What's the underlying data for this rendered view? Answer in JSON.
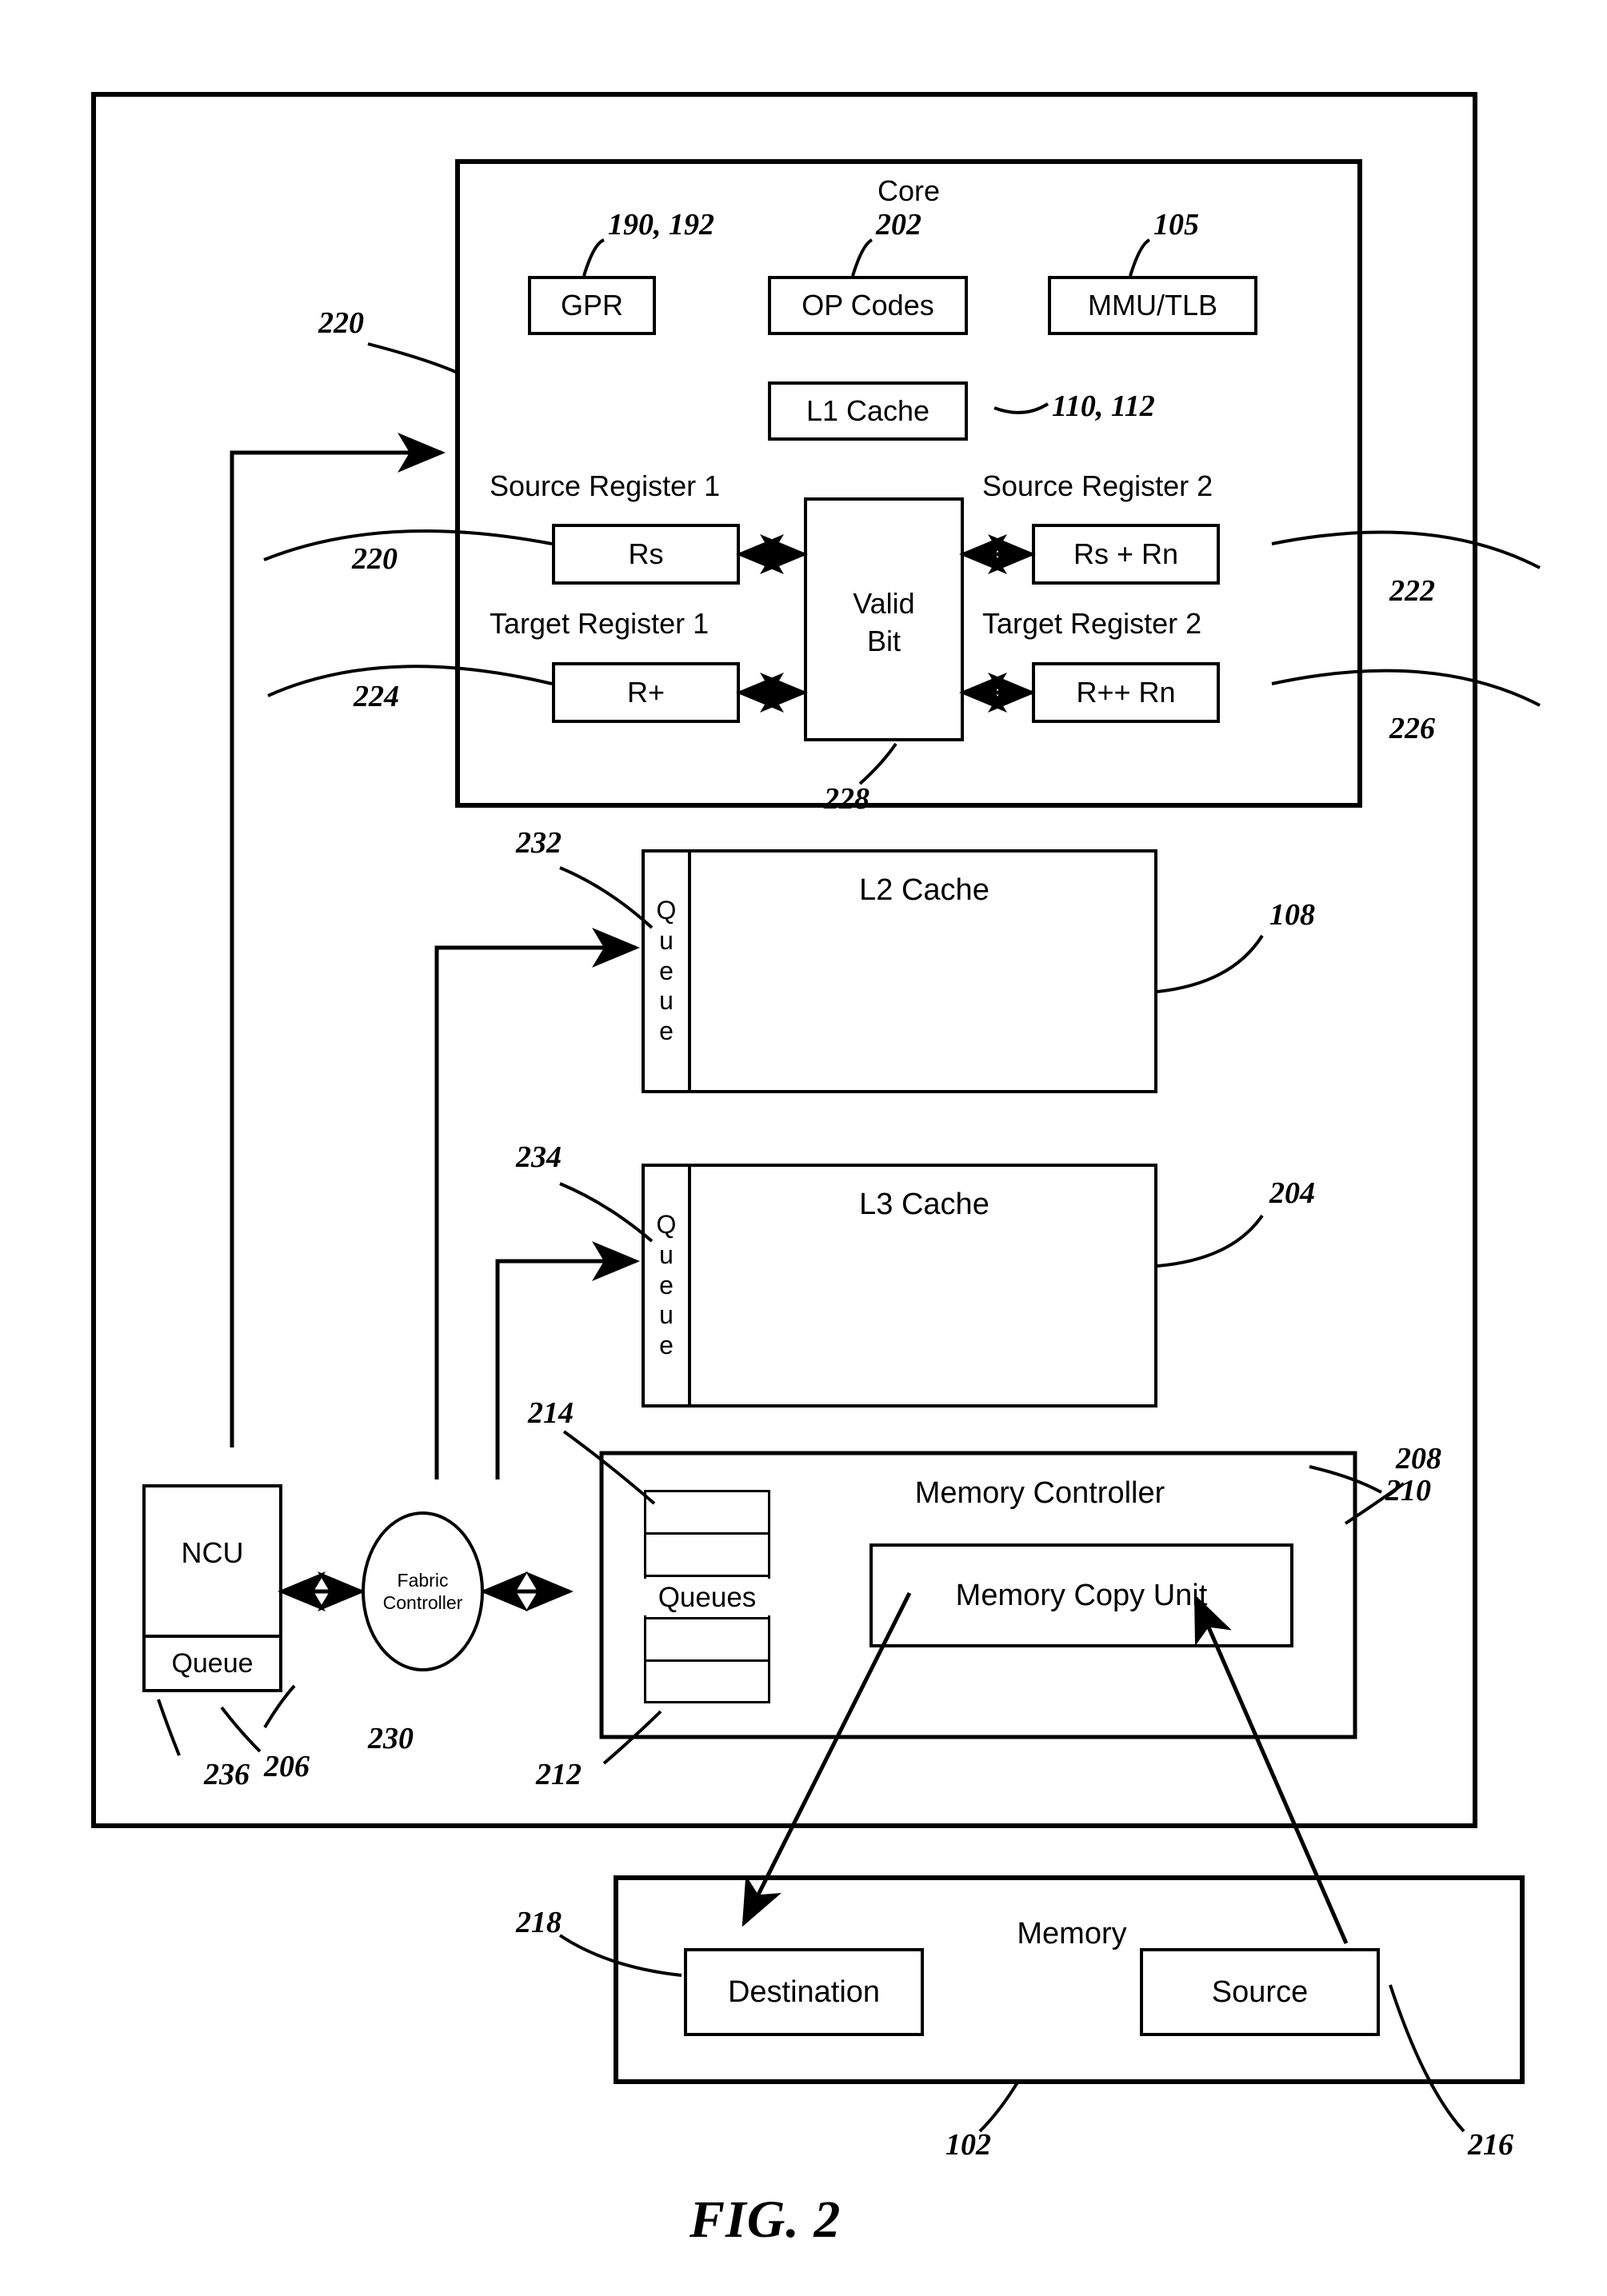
{
  "figure": {
    "caption": "FIG. 2"
  },
  "chip": {
    "core": {
      "title": "Core",
      "units": [
        {
          "label": "GPR",
          "ref": "190, 192"
        },
        {
          "label": "OP Codes",
          "ref": "202"
        },
        {
          "label": "MMU/TLB",
          "ref": "105"
        },
        {
          "label": "L1 Cache",
          "ref": "110, 112"
        }
      ],
      "registers": {
        "source_register_1": {
          "title": "Source Register 1",
          "value": "Rs",
          "ref": "220"
        },
        "source_register_2": {
          "title": "Source Register 2",
          "value": "Rs + Rn",
          "ref": "222"
        },
        "target_register_1": {
          "title": "Target Register 1",
          "value": "R+",
          "ref": "224"
        },
        "target_register_2": {
          "title": "Target Register 2",
          "value": "R++ Rn",
          "ref": "226"
        },
        "valid_bit": {
          "line1": "Valid",
          "line2": "Bit",
          "ref": "228"
        }
      },
      "inbound_ref": "220"
    },
    "l2_cache": {
      "label": "L2 Cache",
      "queue_label": "Queue",
      "queue_ref": "232",
      "ref": "108"
    },
    "l3_cache": {
      "label": "L3 Cache",
      "queue_label": "Queue",
      "queue_ref": "234",
      "ref": "204"
    },
    "ncu": {
      "label": "NCU",
      "queue_label": "Queue",
      "ref": "206",
      "queue_ref": "236"
    },
    "fabric_controller": {
      "line1": "Fabric",
      "line2": "Controller",
      "ref": "230"
    },
    "memory_controller": {
      "label": "Memory Controller",
      "ref": "208",
      "queues_label": "Queues",
      "queues_ref_top": "214",
      "queues_ref_bottom": "212",
      "memory_copy_unit": {
        "label": "Memory Copy Unit",
        "ref": "210"
      }
    }
  },
  "memory": {
    "label": "Memory",
    "ref": "102",
    "destination": {
      "label": "Destination",
      "ref": "218"
    },
    "source": {
      "label": "Source",
      "ref": "216"
    }
  },
  "colors": {
    "stroke": "#000000",
    "background": "#ffffff"
  }
}
